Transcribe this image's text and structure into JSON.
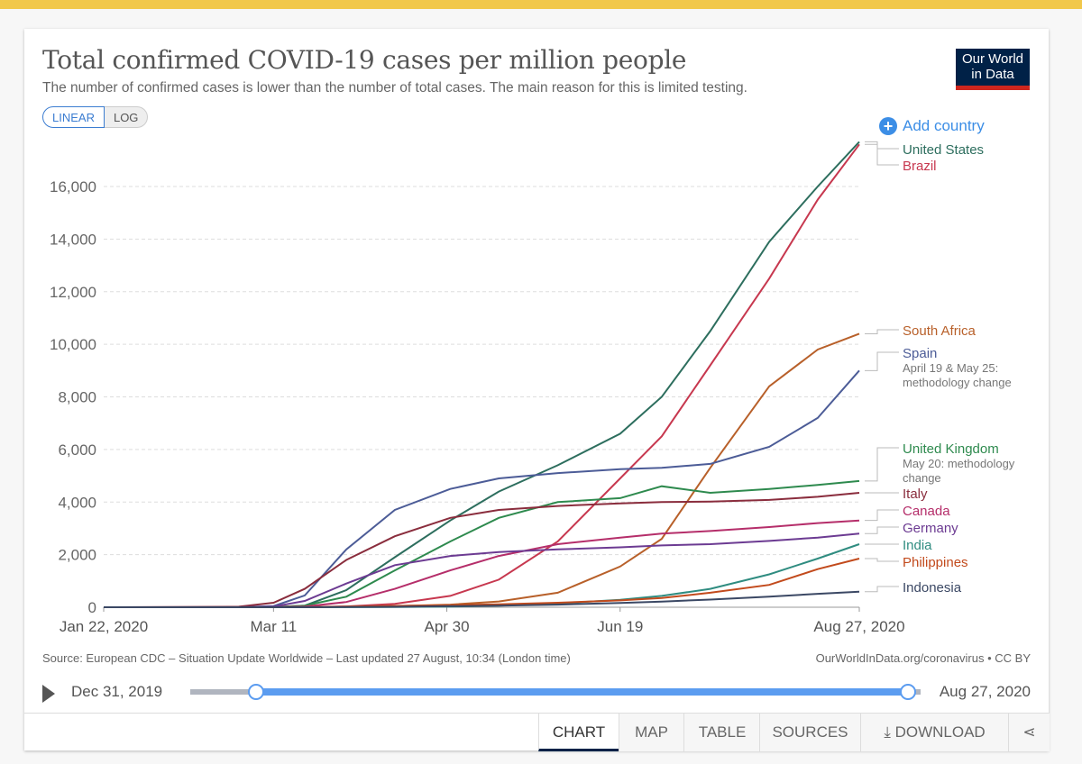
{
  "header": {
    "title": "Total confirmed COVID-19 cases per million people",
    "subtitle": "The number of confirmed cases is lower than the number of total cases. The main reason for this is limited testing.",
    "logo": "Our World in Data",
    "logo_line1": "Our World",
    "logo_line2": "in Data"
  },
  "scale_toggle": {
    "linear": "LINEAR",
    "log": "LOG",
    "selected": "LINEAR"
  },
  "add_country": "Add country",
  "footer": {
    "source": "Source: European CDC – Situation Update Worldwide – Last updated 27 August, 10:34 (London time)",
    "credit": "OurWorldInData.org/coronavirus • CC BY"
  },
  "timeline": {
    "start_label": "Dec 31, 2019",
    "end_label": "Aug 27, 2020",
    "range_start": "2020-01-22",
    "range_end": "2020-08-27"
  },
  "tabs": [
    "CHART",
    "MAP",
    "TABLE",
    "SOURCES",
    "DOWNLOAD"
  ],
  "colors": {
    "accent": "#3c8ee6",
    "brand": "#002147",
    "brand_red": "#ce261e",
    "topbar": "#f1c84b"
  },
  "chart_data": {
    "type": "line",
    "title": "Total confirmed COVID-19 cases per million people",
    "subtitle": "The number of confirmed cases is lower than the number of total cases. The main reason for this is limited testing.",
    "xlim": [
      "2020-01-22",
      "2020-08-27"
    ],
    "ylim": [
      0,
      17700
    ],
    "x_tick_labels": [
      "Jan 22, 2020",
      "Mar 11",
      "Apr 30",
      "Jun 19",
      "Aug 27, 2020"
    ],
    "x_ticks": [
      "2020-01-22",
      "2020-03-11",
      "2020-04-30",
      "2020-06-19",
      "2020-08-27"
    ],
    "y_ticks": [
      0,
      2000,
      4000,
      6000,
      8000,
      10000,
      12000,
      14000,
      16000
    ],
    "y_tick_labels": [
      "0",
      "2,000",
      "4,000",
      "6,000",
      "8,000",
      "10,000",
      "12,000",
      "14,000",
      "16,000"
    ],
    "grid": "horizontal dashed",
    "legend": "right, inline labels",
    "dates": [
      "2020-01-22",
      "2020-03-01",
      "2020-03-11",
      "2020-03-20",
      "2020-04-01",
      "2020-04-15",
      "2020-05-01",
      "2020-05-15",
      "2020-06-01",
      "2020-06-19",
      "2020-07-01",
      "2020-07-15",
      "2020-08-01",
      "2020-08-15",
      "2020-08-27"
    ],
    "series": [
      {
        "name": "United States",
        "color": "#2d6e5e",
        "values": [
          0,
          0,
          3,
          60,
          650,
          1900,
          3300,
          4400,
          5400,
          6600,
          8000,
          10500,
          13900,
          16000,
          17700
        ]
      },
      {
        "name": "Brazil",
        "color": "#c7384f",
        "values": [
          0,
          0,
          0,
          3,
          30,
          130,
          430,
          1050,
          2500,
          4900,
          6500,
          9200,
          12500,
          15500,
          17600
        ]
      },
      {
        "name": "South Africa",
        "color": "#b8602a",
        "values": [
          0,
          0,
          0,
          3,
          25,
          45,
          100,
          220,
          550,
          1550,
          2600,
          5300,
          8400,
          9800,
          10400
        ]
      },
      {
        "name": "Spain",
        "note": "April 19 & May 25: methodology change",
        "color": "#4c5c97",
        "values": [
          0,
          2,
          45,
          450,
          2200,
          3700,
          4500,
          4900,
          5100,
          5250,
          5300,
          5450,
          6100,
          7200,
          9000
        ]
      },
      {
        "name": "United Kingdom",
        "note": "May 20: methodology change",
        "color": "#2e8a4e",
        "values": [
          0,
          0,
          6,
          60,
          400,
          1400,
          2500,
          3400,
          4000,
          4150,
          4600,
          4350,
          4500,
          4650,
          4800
        ]
      },
      {
        "name": "Italy",
        "color": "#8a2d3d",
        "values": [
          0,
          20,
          170,
          700,
          1800,
          2700,
          3400,
          3700,
          3850,
          3950,
          4000,
          4020,
          4080,
          4200,
          4350
        ]
      },
      {
        "name": "Canada",
        "color": "#b52e6a",
        "values": [
          0,
          0,
          3,
          25,
          200,
          700,
          1400,
          1950,
          2400,
          2650,
          2800,
          2900,
          3050,
          3200,
          3300
        ]
      },
      {
        "name": "Germany",
        "color": "#6c3b92",
        "values": [
          0,
          1,
          25,
          240,
          900,
          1600,
          1950,
          2100,
          2200,
          2280,
          2350,
          2400,
          2520,
          2650,
          2800
        ]
      },
      {
        "name": "India",
        "color": "#2f8c80",
        "values": [
          0,
          0,
          0,
          0,
          2,
          9,
          25,
          60,
          140,
          280,
          430,
          700,
          1250,
          1850,
          2400
        ]
      },
      {
        "name": "Philippines",
        "color": "#c24a1c",
        "values": [
          0,
          0,
          0,
          2,
          20,
          50,
          80,
          110,
          170,
          260,
          350,
          550,
          850,
          1450,
          1850
        ]
      },
      {
        "name": "Indonesia",
        "color": "#3b4864",
        "values": [
          0,
          0,
          0,
          1,
          6,
          18,
          40,
          60,
          100,
          165,
          215,
          290,
          400,
          510,
          590
        ]
      }
    ]
  }
}
